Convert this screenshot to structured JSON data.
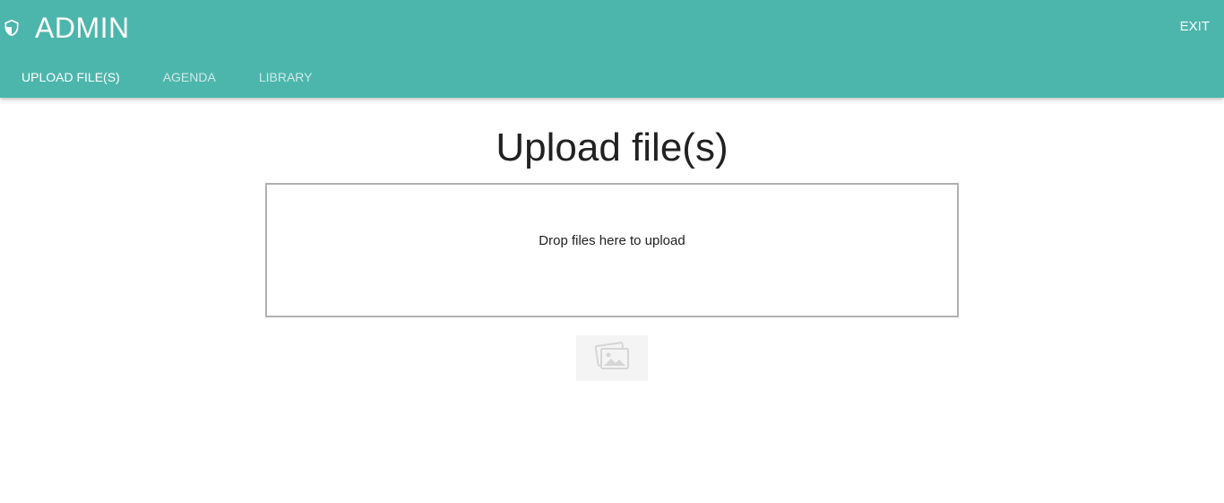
{
  "header": {
    "title": "ADMIN",
    "exit_label": "EXIT",
    "brand_color": "#4db6ac",
    "logo_icon": "shield-icon"
  },
  "tabs": [
    {
      "label": "UPLOAD FILE(S)",
      "active": true
    },
    {
      "label": "AGENDA",
      "active": false
    },
    {
      "label": "LIBRARY",
      "active": false
    }
  ],
  "main": {
    "title": "Upload file(s)",
    "dropzone_text": "Drop files here to upload",
    "preview_icon": "image-placeholder-icon"
  }
}
